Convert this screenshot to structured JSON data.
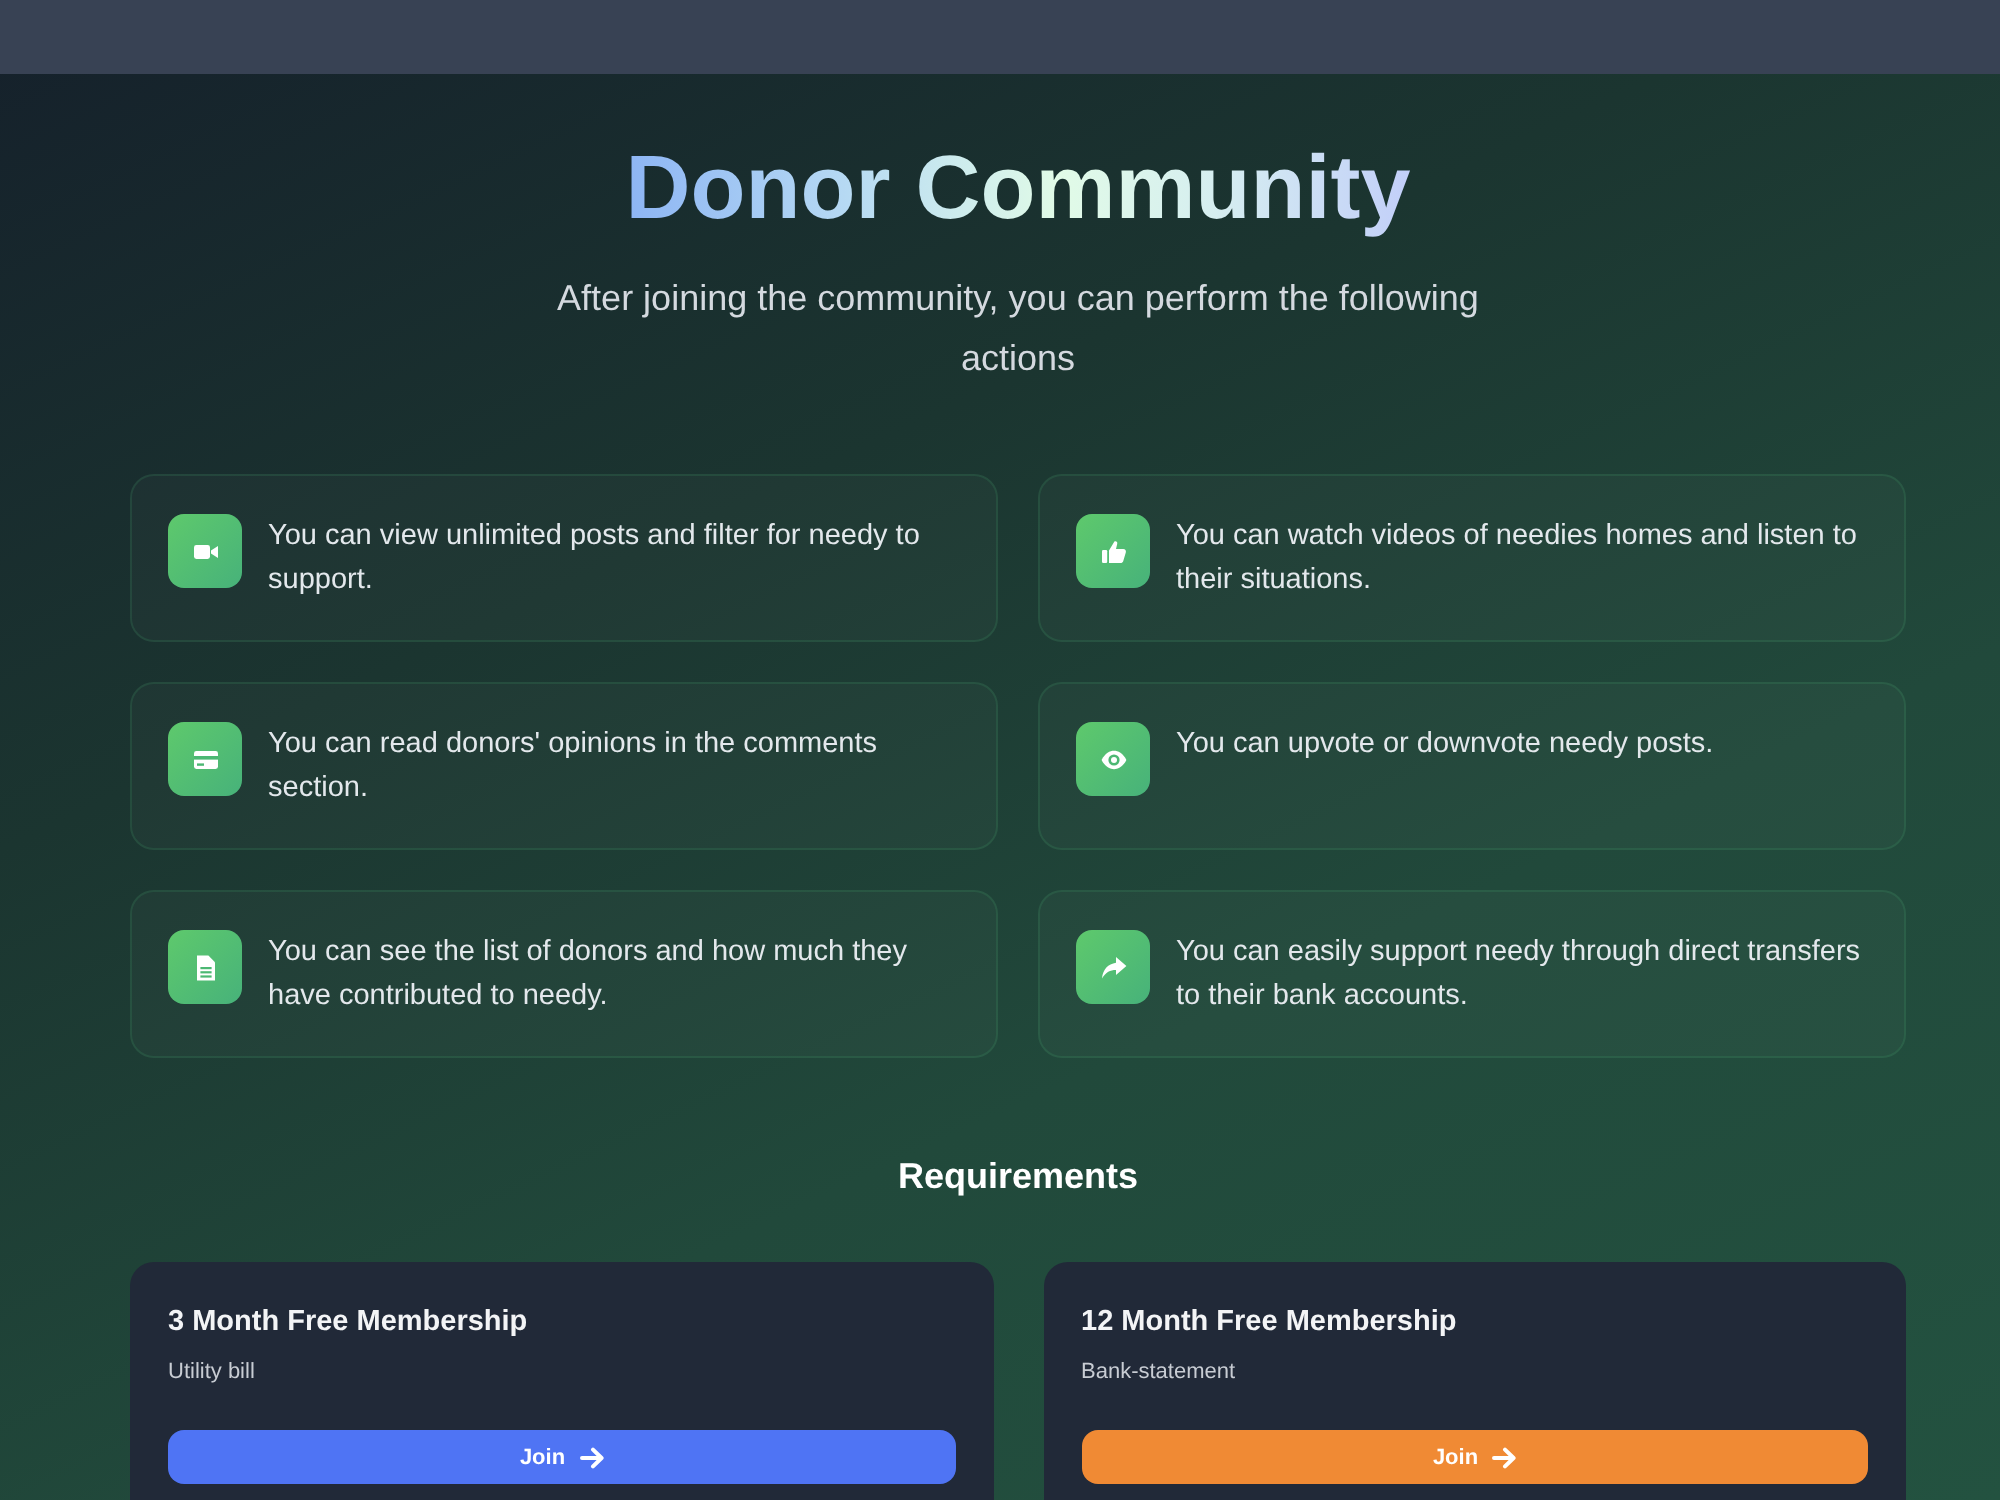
{
  "title": "Donor Community",
  "subtitle": "After joining the community, you can perform the following actions",
  "features": [
    "You can view unlimited posts and filter for needy to support.",
    "You can watch videos of needies homes and listen to their situations.",
    "You can read donors' opinions in the comments section.",
    "You can upvote or downvote needy posts.",
    "You can see the list of donors and how much they have contributed to needy.",
    "You can easily support needy through direct transfers to their bank accounts."
  ],
  "requirements": {
    "heading": "Requirements",
    "plans": [
      {
        "title": "3 Month Free Membership",
        "document": "Utility bill",
        "button": "Join",
        "color": "#4f74f4"
      },
      {
        "title": "12 Month Free Membership",
        "document": "Bank-statement",
        "button": "Join",
        "color": "#f08a34"
      }
    ]
  }
}
